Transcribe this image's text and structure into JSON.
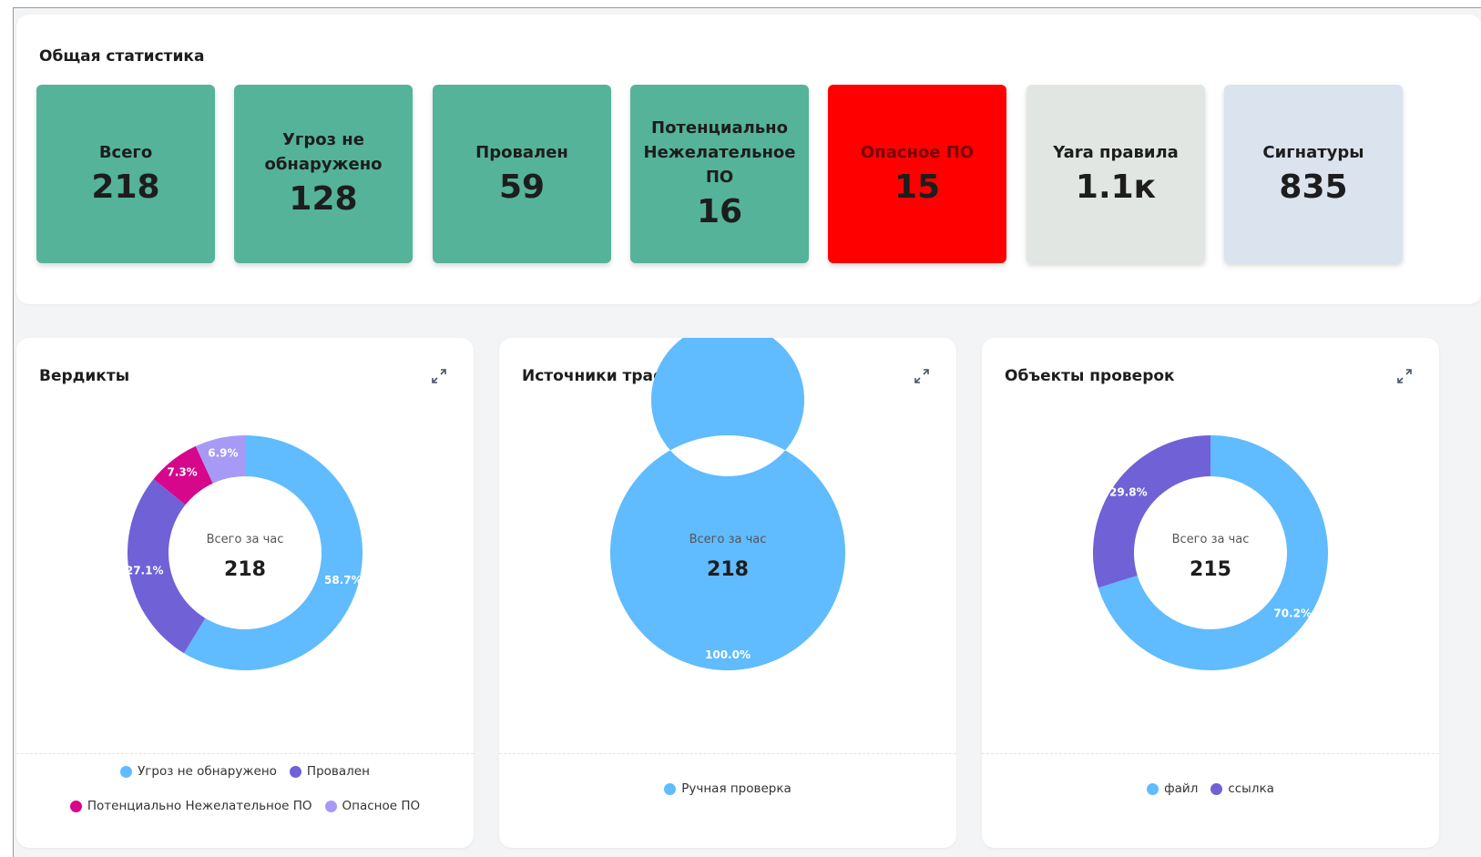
{
  "stats": {
    "title": "Общая статистика",
    "tiles": [
      {
        "label": "Всего",
        "value": "218",
        "bg": "#55b399",
        "fg": "#1d1d1d"
      },
      {
        "label": "Угроз не обнаружено",
        "value": "128",
        "bg": "#55b399",
        "fg": "#1d1d1d"
      },
      {
        "label": "Провален",
        "value": "59",
        "bg": "#55b399",
        "fg": "#1d1d1d"
      },
      {
        "label": "Потенциально Нежелательное ПО",
        "value": "16",
        "bg": "#55b399",
        "fg": "#1d1d1d"
      },
      {
        "label": "Опасное ПО",
        "value": "15",
        "bg": "#ff0000",
        "fg": "#7a0000",
        "valueColor": "#1d1d1d"
      },
      {
        "label": "Yara правила",
        "value": "1.1к",
        "bg": "#e1e6e3",
        "fg": "#1d1d1d"
      },
      {
        "label": "Сигнатуры",
        "value": "835",
        "bg": "#dbe3ef",
        "fg": "#1d1d1d"
      }
    ]
  },
  "charts": [
    {
      "title": "Вердикты",
      "center_label": "Всего за час",
      "center_value": "218",
      "legend_rows": [
        [
          "Угроз не обнаружено",
          "Провален"
        ],
        [
          "Потенциально Нежелательное ПО",
          "Опасное ПО"
        ]
      ]
    },
    {
      "title": "Источники трафика",
      "center_label": "Всего за час",
      "center_value": "218",
      "legend_rows": [
        [
          "Ручная проверка"
        ]
      ]
    },
    {
      "title": "Объекты проверок",
      "center_label": "Всего за час",
      "center_value": "215",
      "legend_rows": [
        [
          "файл",
          "ссылка"
        ]
      ]
    }
  ],
  "chart_data": [
    {
      "type": "pie",
      "title": "Вердикты",
      "series": [
        {
          "name": "Угроз не обнаружено",
          "value": 58.7,
          "label": "58.7%",
          "color": "#60bbff"
        },
        {
          "name": "Провален",
          "value": 27.1,
          "label": "27.1%",
          "color": "#7061d7"
        },
        {
          "name": "Потенциально Нежелательное ПО",
          "value": 7.3,
          "label": "7.3%",
          "color": "#d6078b"
        },
        {
          "name": "Опасное ПО",
          "value": 6.9,
          "label": "6.9%",
          "color": "#a79af6"
        }
      ]
    },
    {
      "type": "pie",
      "title": "Источники трафика",
      "series": [
        {
          "name": "Ручная проверка",
          "value": 100.0,
          "label": "100.0%",
          "color": "#60bbff"
        }
      ]
    },
    {
      "type": "pie",
      "title": "Объекты проверок",
      "series": [
        {
          "name": "файл",
          "value": 70.2,
          "label": "70.2%",
          "color": "#60bbff"
        },
        {
          "name": "ссылка",
          "value": 29.8,
          "label": "29.8%",
          "color": "#7061d7"
        }
      ]
    }
  ]
}
